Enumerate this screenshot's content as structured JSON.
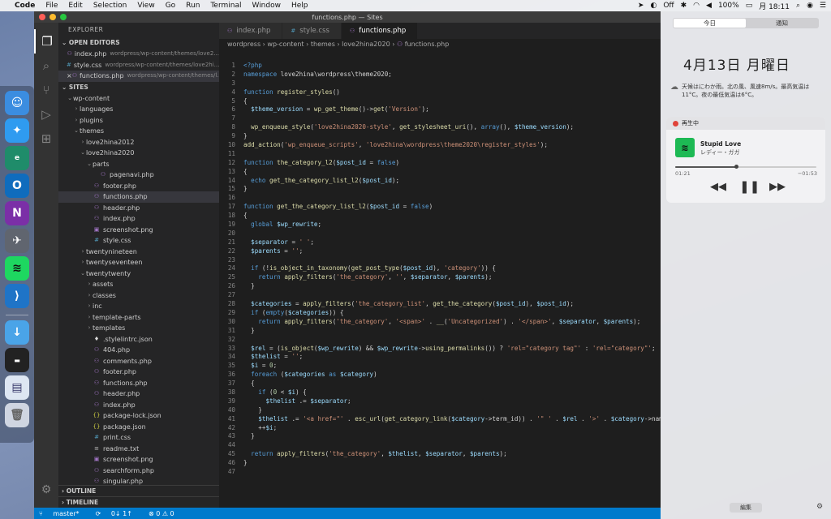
{
  "menubar": {
    "apple": "",
    "app": "Code",
    "items": [
      "File",
      "Edit",
      "Selection",
      "View",
      "Go",
      "Run",
      "Terminal",
      "Window",
      "Help"
    ],
    "status": {
      "battery": "100%",
      "date": "月 18:11",
      "sync": "Off"
    }
  },
  "window": {
    "title": "functions.php — Sites"
  },
  "sidebar": {
    "title": "EXPLORER",
    "open_editors_label": "OPEN EDITORS",
    "open_editors": [
      {
        "name": "index.php",
        "path": "wordpress/wp-content/themes/love2...",
        "type": "php"
      },
      {
        "name": "style.css",
        "path": "wordpress/wp-content/themes/love2hi...",
        "type": "css"
      },
      {
        "name": "functions.php",
        "path": "wordpress/wp-content/themes/l...",
        "type": "php",
        "close": "×"
      }
    ],
    "sites_label": "SITES",
    "tree": [
      {
        "name": "wp-content",
        "depth": 1,
        "kind": "open"
      },
      {
        "name": "languages",
        "depth": 2,
        "kind": "closed"
      },
      {
        "name": "plugins",
        "depth": 2,
        "kind": "closed"
      },
      {
        "name": "themes",
        "depth": 2,
        "kind": "open"
      },
      {
        "name": "love2hina2012",
        "depth": 3,
        "kind": "closed"
      },
      {
        "name": "love2hina2020",
        "depth": 3,
        "kind": "open"
      },
      {
        "name": "parts",
        "depth": 4,
        "kind": "open"
      },
      {
        "name": "pagenavi.php",
        "depth": 5,
        "kind": "php"
      },
      {
        "name": "footer.php",
        "depth": 4,
        "kind": "php"
      },
      {
        "name": "functions.php",
        "depth": 4,
        "kind": "php",
        "selected": true
      },
      {
        "name": "header.php",
        "depth": 4,
        "kind": "php"
      },
      {
        "name": "index.php",
        "depth": 4,
        "kind": "php"
      },
      {
        "name": "screenshot.png",
        "depth": 4,
        "kind": "img"
      },
      {
        "name": "style.css",
        "depth": 4,
        "kind": "css"
      },
      {
        "name": "twentynineteen",
        "depth": 3,
        "kind": "closed"
      },
      {
        "name": "twentyseventeen",
        "depth": 3,
        "kind": "closed"
      },
      {
        "name": "twentytwenty",
        "depth": 3,
        "kind": "open"
      },
      {
        "name": "assets",
        "depth": 4,
        "kind": "closed"
      },
      {
        "name": "classes",
        "depth": 4,
        "kind": "closed"
      },
      {
        "name": "inc",
        "depth": 4,
        "kind": "closed"
      },
      {
        "name": "template-parts",
        "depth": 4,
        "kind": "closed"
      },
      {
        "name": "templates",
        "depth": 4,
        "kind": "closed"
      },
      {
        "name": ".stylelintrc.json",
        "depth": 4,
        "kind": "cfg"
      },
      {
        "name": "404.php",
        "depth": 4,
        "kind": "php"
      },
      {
        "name": "comments.php",
        "depth": 4,
        "kind": "php"
      },
      {
        "name": "footer.php",
        "depth": 4,
        "kind": "php"
      },
      {
        "name": "functions.php",
        "depth": 4,
        "kind": "php"
      },
      {
        "name": "header.php",
        "depth": 4,
        "kind": "php"
      },
      {
        "name": "index.php",
        "depth": 4,
        "kind": "php"
      },
      {
        "name": "package-lock.json",
        "depth": 4,
        "kind": "json"
      },
      {
        "name": "package.json",
        "depth": 4,
        "kind": "json"
      },
      {
        "name": "print.css",
        "depth": 4,
        "kind": "css"
      },
      {
        "name": "readme.txt",
        "depth": 4,
        "kind": "txt"
      },
      {
        "name": "screenshot.png",
        "depth": 4,
        "kind": "img"
      },
      {
        "name": "searchform.php",
        "depth": 4,
        "kind": "php"
      },
      {
        "name": "singular.php",
        "depth": 4,
        "kind": "php"
      }
    ],
    "outline_label": "OUTLINE",
    "timeline_label": "TIMELINE"
  },
  "editor": {
    "tabs": [
      {
        "name": "index.php",
        "type": "php",
        "active": false
      },
      {
        "name": "style.css",
        "type": "css",
        "active": false
      },
      {
        "name": "functions.php",
        "type": "php",
        "active": true
      }
    ],
    "breadcrumbs": [
      "wordpress",
      "wp-content",
      "themes",
      "love2hina2020",
      "functions.php"
    ],
    "lines": [
      "<?php",
      "namespace love2hina\\wordpress\\theme2020;",
      "",
      "function register_styles()",
      "{",
      "  $theme_version = wp_get_theme()->get('Version');",
      "",
      "  wp_enqueue_style('love2hina2020-style', get_stylesheet_uri(), array(), $theme_version);",
      "}",
      "add_action('wp_enqueue_scripts', 'love2hina\\wordpress\\theme2020\\register_styles');",
      "",
      "function the_category_l2($post_id = false)",
      "{",
      "  echo get_the_category_list_l2($post_id);",
      "}",
      "",
      "function get_the_category_list_l2($post_id = false)",
      "{",
      "  global $wp_rewrite;",
      "",
      "  $separator = ' ';",
      "  $parents = '';",
      "",
      "  if (!is_object_in_taxonomy(get_post_type($post_id), 'category')) {",
      "    return apply_filters('the_category', '', $separator, $parents);",
      "  }",
      "",
      "  $categories = apply_filters('the_category_list', get_the_category($post_id), $post_id);",
      "  if (empty($categories)) {",
      "    return apply_filters('the_category', '<span>' . __('Uncategorized') . '</span>', $separator, $parents);",
      "  }",
      "",
      "  $rel = (is_object($wp_rewrite) && $wp_rewrite->using_permalinks()) ? 'rel=\"category tag\"' : 'rel=\"category\"';",
      "  $thelist = '';",
      "  $i = 0;",
      "  foreach ($categories as $category)",
      "  {",
      "    if (0 < $i) {",
      "      $thelist .= $separator;",
      "    }",
      "    $thelist .= '<a href=\"' . esc_url(get_category_link($category->term_id)) . '\" ' . $rel . '>' . $category->name",
      "    ++$i;",
      "  }",
      "",
      "  return apply_filters('the_category', $thelist, $separator, $parents);",
      "}",
      ""
    ]
  },
  "statusbar": {
    "branch": "master*",
    "sync": "0↓ 1↑",
    "problems": "⊗ 0 ⚠ 0"
  },
  "notification_center": {
    "tab_today": "今日",
    "tab_notifications": "通知",
    "date": "4月13日 月曜日",
    "weather": "天候はにわか雨。北の風、風速8m/s。最高気温は11°C。夜の最低気温は6°C。",
    "now_playing_label": "再生中",
    "song": "Stupid Love",
    "artist": "レディー・ガガ",
    "elapsed": "01:21",
    "remaining": "−01:53",
    "progress": 0.43,
    "edit_label": "編集"
  }
}
